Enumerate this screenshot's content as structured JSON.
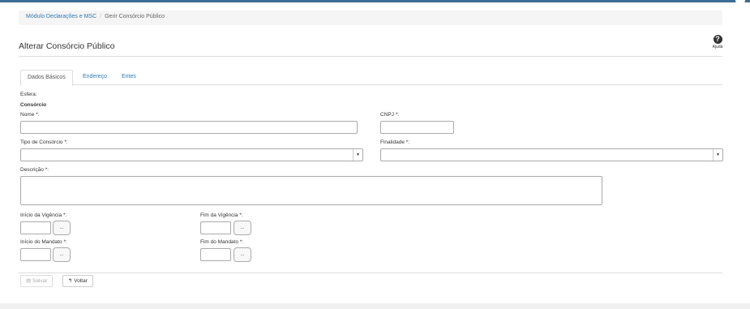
{
  "breadcrumb": {
    "module": "Módulo Declarações e MSC",
    "separator": "/",
    "current": "Gerir Consórcio Público"
  },
  "page": {
    "title": "Alterar Consórcio Público"
  },
  "help": {
    "icon": "question-circle-icon",
    "label": "Ajuda"
  },
  "tabs": [
    {
      "label": "Dados Básicos",
      "active": true
    },
    {
      "label": "Endereço",
      "active": false
    },
    {
      "label": "Entes",
      "active": false
    }
  ],
  "form": {
    "esfera_label": "Esfera:",
    "consorcio_label": "Consórcio",
    "nome_label": "Nome *:",
    "nome_value": "",
    "cnpj_label": "CNPJ *:",
    "cnpj_value": "",
    "tipo_label": "Tipo de Consórcio *:",
    "tipo_value": "",
    "finalidade_label": "Finalidade *:",
    "finalidade_value": "",
    "descricao_label": "Descrição *:",
    "descricao_value": "",
    "inicio_vigencia_label": "Início da Vigência *:",
    "fim_vigencia_label": "Fim da Vigência *:",
    "inicio_mandato_label": "Início do Mandato *:",
    "fim_mandato_label": "Fim do Mandato *:",
    "date_button_label": "..."
  },
  "actions": {
    "save_label": "Salvar",
    "save_icon": "save-icon",
    "back_label": "Voltar",
    "back_icon": "reply-icon"
  },
  "colors": {
    "topbar": "#3c6e95",
    "link": "#2a7ab8"
  }
}
